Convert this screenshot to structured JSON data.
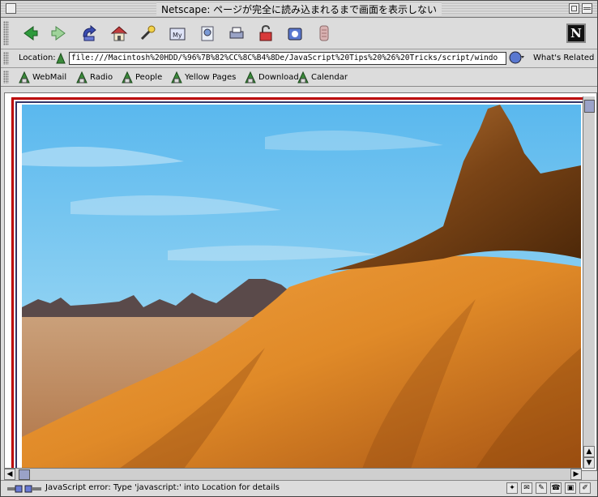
{
  "window": {
    "title": "Netscape: ページが完全に読み込まれるまで画面を表示しない"
  },
  "toolbar": {
    "buttons": [
      {
        "name": "back-button",
        "icon": "back-arrow-icon"
      },
      {
        "name": "forward-button",
        "icon": "forward-arrow-icon"
      },
      {
        "name": "reload-button",
        "icon": "reload-icon"
      },
      {
        "name": "home-button",
        "icon": "home-icon"
      },
      {
        "name": "search-button",
        "icon": "search-icon"
      },
      {
        "name": "my-netscape-button",
        "icon": "my-netscape-icon",
        "label": "My"
      },
      {
        "name": "images-button",
        "icon": "images-icon"
      },
      {
        "name": "print-button",
        "icon": "print-icon"
      },
      {
        "name": "security-button",
        "icon": "lock-icon"
      },
      {
        "name": "shop-button",
        "icon": "shop-icon"
      },
      {
        "name": "stop-button",
        "icon": "stop-icon"
      }
    ],
    "logo": "N"
  },
  "location": {
    "label": "Location:",
    "url": "file:///Macintosh%20HDD/%96%7B%82%CC%8C%B4%8De/JavaScript%20Tips%20%26%20Tricks/script/windo",
    "whats_related": "What's Related"
  },
  "personal_toolbar": {
    "items": [
      {
        "label": "WebMail"
      },
      {
        "label": "Radio"
      },
      {
        "label": "People"
      },
      {
        "label": "Yellow Pages"
      },
      {
        "label": "Download"
      },
      {
        "label": "Calendar"
      }
    ]
  },
  "status": {
    "text": "JavaScript error: Type 'javascript:' into Location for details"
  },
  "colors": {
    "frame_red": "#b00000",
    "frame_blue": "#333366",
    "sky": "#7cc6ee",
    "terrain": "#e08a2a"
  }
}
